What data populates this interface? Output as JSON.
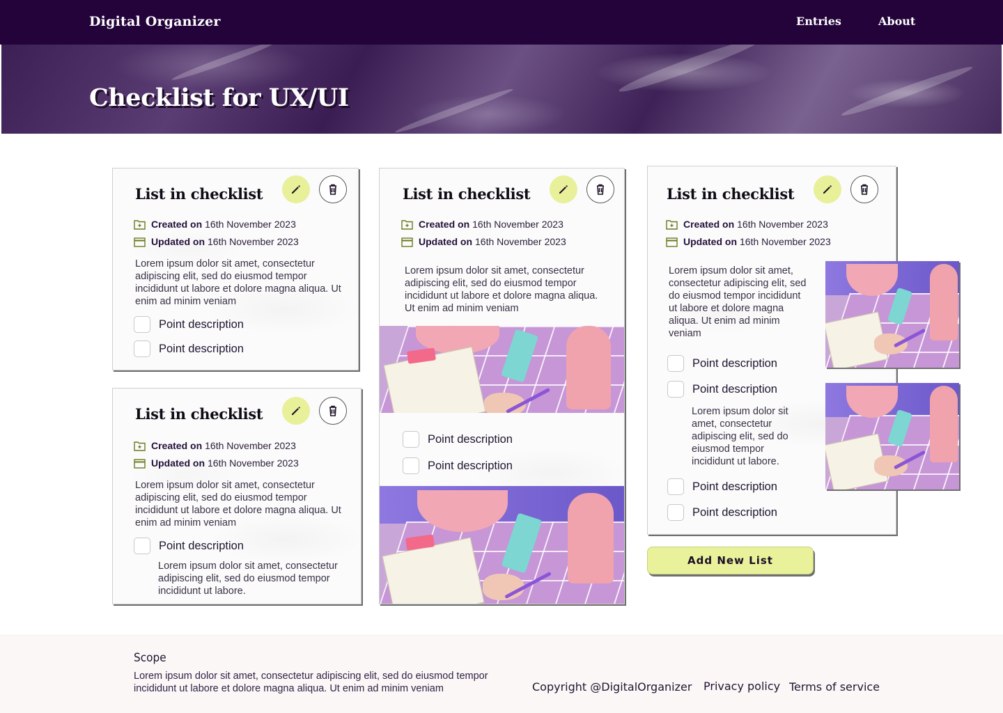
{
  "nav": {
    "brand": "Digital Organizer",
    "links": [
      "Entries",
      "About"
    ]
  },
  "hero": {
    "title": "Checklist for UX/UI"
  },
  "common": {
    "card_title": "List in checklist",
    "created_label": "Created on",
    "updated_label": "Updated on",
    "date": "16th November 2023",
    "lorem": "Lorem ipsum dolor sit amet, consectetur adipiscing elit, sed do eiusmod tempor incididunt ut labore et dolore magna aliqua. Ut enim ad minim veniam",
    "point": "Point description",
    "sub1": "Lorem ipsum dolor sit amet, consectetur adipiscing elit, sed do eiusmod tempor incididunt ut labore.",
    "sub2": "Lorem ipsum dolor sit amet, consectetur adipiscing elit, sed do eiusmod tempor incididunt ut labore."
  },
  "add_button": "Add New List",
  "footer": {
    "scope_title": "Scope",
    "scope_text": "Lorem ipsum dolor sit amet, consectetur adipiscing elit, sed do eiusmod tempor incididunt ut labore et dolore magna aliqua. Ut enim ad minim veniam",
    "copyright": "Copyright @DigitalOrganizer",
    "privacy": "Privacy policy",
    "terms": "Terms of service"
  },
  "colors": {
    "nav_bg": "#23033a",
    "accent": "#e8f09a",
    "footer_bg": "#fcf7f7"
  },
  "icons": [
    "pencil-icon",
    "trash-icon",
    "folder-add-icon",
    "calendar-icon"
  ]
}
